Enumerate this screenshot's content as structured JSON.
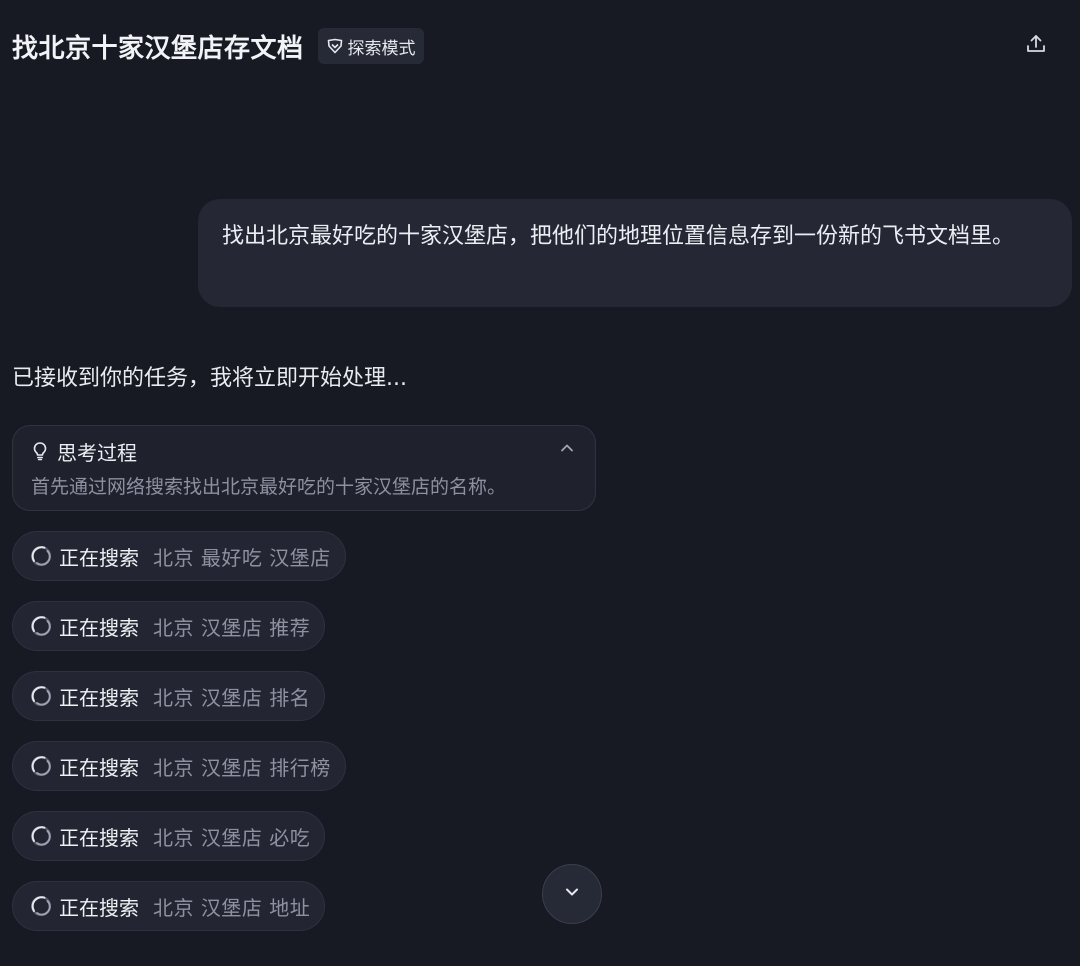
{
  "header": {
    "title": "找北京十家汉堡店存文档",
    "mode_badge": "探索模式",
    "share_icon": "share-upload-icon"
  },
  "conversation": {
    "user_message": "找出北京最好吃的十家汉堡店，把他们的地理位置信息存到一份新的飞书文档里。",
    "assistant_reply": "已接收到你的任务，我将立即开始处理...",
    "thinking": {
      "title": "思考过程",
      "content": "首先通过网络搜索找出北京最好吃的十家汉堡店的名称。",
      "icon": "lightbulb-icon",
      "expanded": true
    },
    "searches": [
      {
        "label": "正在搜索",
        "query": "北京 最好吃 汉堡店"
      },
      {
        "label": "正在搜索",
        "query": "北京 汉堡店 推荐"
      },
      {
        "label": "正在搜索",
        "query": "北京 汉堡店 排名"
      },
      {
        "label": "正在搜索",
        "query": "北京 汉堡店 排行榜"
      },
      {
        "label": "正在搜索",
        "query": "北京 汉堡店 必吃"
      },
      {
        "label": "正在搜索",
        "query": "北京 汉堡店 地址"
      }
    ]
  },
  "colors": {
    "background": "#171923",
    "bubble": "#252834",
    "pill": "#232632",
    "muted_text": "#8d91a0"
  }
}
